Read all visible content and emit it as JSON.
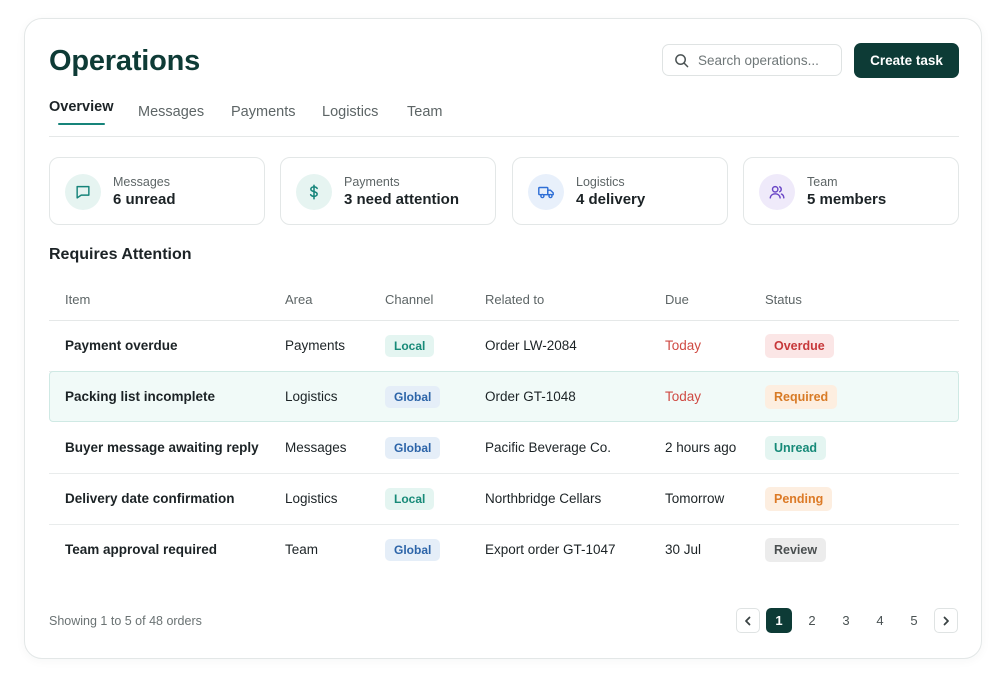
{
  "header": {
    "title": "Operations",
    "search_placeholder": "Search operations...",
    "create_label": "Create task"
  },
  "tabs": [
    {
      "label": "Overview",
      "active": true
    },
    {
      "label": "Messages"
    },
    {
      "label": "Payments"
    },
    {
      "label": "Logistics"
    },
    {
      "label": "Team"
    }
  ],
  "stats": [
    {
      "label": "Messages",
      "value": "6 unread",
      "icon": "message-icon",
      "color": "#16847a"
    },
    {
      "label": "Payments",
      "value": "3 need attention",
      "icon": "dollar-icon",
      "color": "#16847a"
    },
    {
      "label": "Logistics",
      "value": "4 delivery",
      "icon": "truck-icon",
      "color": "#2f6fd6"
    },
    {
      "label": "Team",
      "value": "5 members",
      "icon": "users-icon",
      "color": "#6a46c6"
    }
  ],
  "section_title": "Requires Attention",
  "table": {
    "headers": [
      "Item",
      "Area",
      "Channel",
      "Related to",
      "Due",
      "Status"
    ],
    "rows": [
      {
        "item": "Payment overdue",
        "area": "Payments",
        "channel": "Local",
        "related": "Order LW-2084",
        "due": "Today",
        "status": "Overdue"
      },
      {
        "item": "Packing list incomplete",
        "area": "Logistics",
        "channel": "Global",
        "related": "Order GT-1048",
        "due": "Today",
        "status": "Required"
      },
      {
        "item": "Buyer message awaiting reply",
        "area": "Messages",
        "channel": "Global",
        "related": "Pacific Beverage Co.",
        "due": "2 hours ago",
        "status": "Unread"
      },
      {
        "item": "Delivery date confirmation",
        "area": "Logistics",
        "channel": "Local",
        "related": "Northbridge Cellars",
        "due": "Tomorrow",
        "status": "Pending"
      },
      {
        "item": "Team approval required",
        "area": "Team",
        "channel": "Global",
        "related": "Export order GT-1047",
        "due": "30 Jul",
        "status": "Review"
      }
    ]
  },
  "footer": {
    "showing": "Showing 1 to 5 of 48 orders",
    "pages": [
      "1",
      "2",
      "3",
      "4",
      "5"
    ],
    "current_page": "1"
  },
  "colors": {
    "brand": "#0d3b36",
    "accent": "#16847a",
    "danger": "#cf4a43"
  }
}
